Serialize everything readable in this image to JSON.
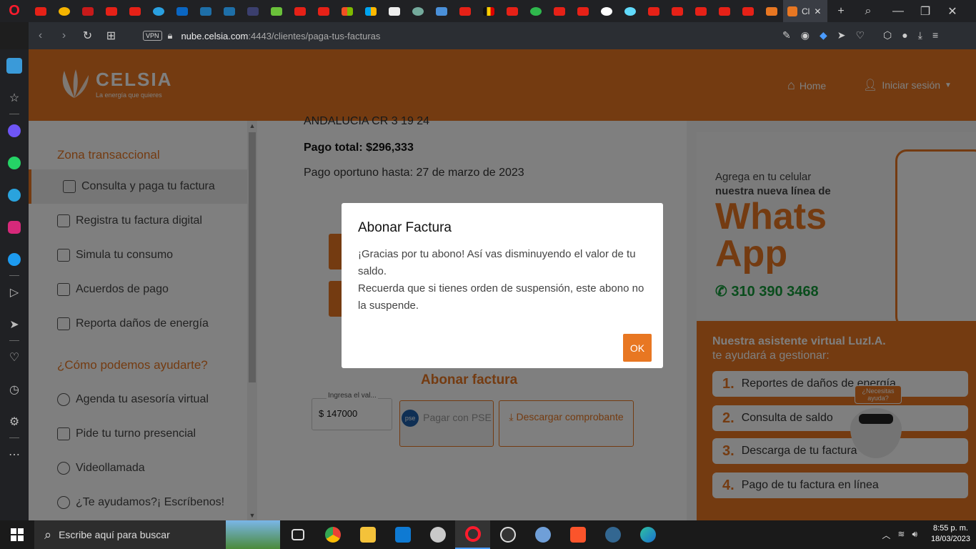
{
  "browser": {
    "active_tab_label": "Cl",
    "url_host": "nube.celsia.com",
    "url_rest": ":4443/clientes/paga-tus-facturas",
    "vpn_label": "VPN"
  },
  "site": {
    "brand_name": "CELSIA",
    "brand_tagline": "La energía que quieres",
    "nav_home": "Home",
    "nav_login": "Iniciar sesión"
  },
  "sidebar": {
    "section1_title": "Zona transaccional",
    "items1": [
      {
        "label": "Consulta y paga tu factura"
      },
      {
        "label": "Registra tu factura digital"
      },
      {
        "label": "Simula tu consumo"
      },
      {
        "label": "Acuerdos de pago"
      },
      {
        "label": "Reporta daños de energía"
      }
    ],
    "section2_title": "¿Cómo podemos ayudarte?",
    "items2": [
      {
        "label": "Agenda tu asesoría virtual"
      },
      {
        "label": "Pide tu turno presencial"
      },
      {
        "label": "Videollamada"
      },
      {
        "label": "¿Te ayudamos?¡ Escríbenos!"
      }
    ]
  },
  "bill": {
    "address": "ANDALUCIA CR 3 19 24",
    "total": "Pago total: $296,333",
    "due": "Pago oportuno hasta: 27 de marzo de 2023",
    "abonar_title": "Abonar factura",
    "amount_label": "Ingresa el val...",
    "amount_value": "147000",
    "currency": "$",
    "pse_logo": "pse",
    "pse_label": "Pagar con PSE",
    "download_label": "Descargar comprobante"
  },
  "banner": {
    "wa_line1": "Agrega en tu celular",
    "wa_line2": "nuestra nueva línea de",
    "wa_big": "Whats App",
    "wa_phone": "310 390 3468",
    "assist_line1": "Nuestra asistente virtual LuzI.A.",
    "assist_line2": "te ayudará a gestionar:",
    "assist_items": [
      {
        "num": "1.",
        "text": "Reportes de daños de energía"
      },
      {
        "num": "2.",
        "text": "Consulta de saldo"
      },
      {
        "num": "3.",
        "text": "Descarga de tu factura"
      },
      {
        "num": "4.",
        "text": "Pago de tu factura en línea"
      }
    ],
    "robot_bubble": "¿Necesitas ayuda?"
  },
  "modal": {
    "title": "Abonar Factura",
    "body_line1": "¡Gracias por tu abono! Así vas disminuyendo el valor de tu saldo.",
    "body_line2": "Recuerda que si tienes orden de suspensión, este abono no la suspende.",
    "ok": "OK"
  },
  "taskbar": {
    "search_placeholder": "Escribe aquí para buscar",
    "time": "8:55 p. m.",
    "date": "18/03/2023"
  },
  "colors": {
    "brand": "#e87722",
    "whatsapp": "#159b3a"
  }
}
